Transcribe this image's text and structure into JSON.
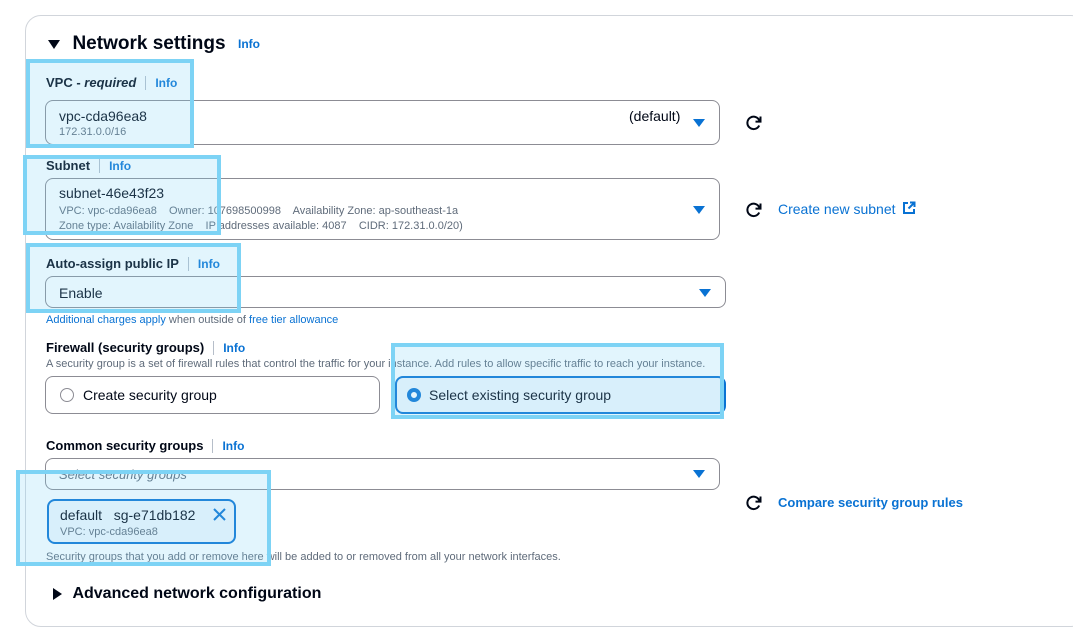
{
  "network": {
    "title": "Network settings",
    "info": "Info"
  },
  "vpc": {
    "label_main": "VPC - ",
    "label_required": "required",
    "info": "Info",
    "value": "vpc-cda96ea8",
    "cidr": "172.31.0.0/16",
    "tag": "(default)"
  },
  "subnet": {
    "label": "Subnet",
    "info": "Info",
    "value": "subnet-46e43f23",
    "detail1": "VPC: vpc-cda96ea8    Owner: 107698500998    Availability Zone: ap-southeast-1a",
    "detail2": "Zone type: Availability Zone    IP addresses available: 4087    CIDR: 172.31.0.0/20)",
    "create_link": "Create new subnet"
  },
  "public_ip": {
    "label": "Auto-assign public IP",
    "info": "Info",
    "value": "Enable",
    "note_link1": "Additional charges apply",
    "note_mid": " when outside of ",
    "note_link2": "free tier allowance"
  },
  "firewall": {
    "label": "Firewall (security groups)",
    "info": "Info",
    "description": "A security group is a set of firewall rules that control the traffic for your instance. Add rules to allow specific traffic to reach your instance.",
    "option_create": "Create security group",
    "option_existing": "Select existing security group",
    "selected": "Select existing security group"
  },
  "common_sg": {
    "label": "Common security groups",
    "info": "Info",
    "placeholder": "Select security groups",
    "token_name": "default",
    "token_id": "sg-e71db182",
    "token_vpc": "VPC: vpc-cda96ea8",
    "compare_link": "Compare security group rules",
    "footnote": "Security groups that you add or remove here will be added to or removed from all your network interfaces."
  },
  "advanced": {
    "title": "Advanced network configuration"
  },
  "colors": {
    "accent": "#0972d3",
    "highlight": "#7dd3f5",
    "text": "#000716",
    "muted": "#5f6b7a"
  },
  "icons": [
    "refresh-icon",
    "external-link-icon",
    "close-icon",
    "caret-down-icon",
    "expand-triangle-icon"
  ]
}
